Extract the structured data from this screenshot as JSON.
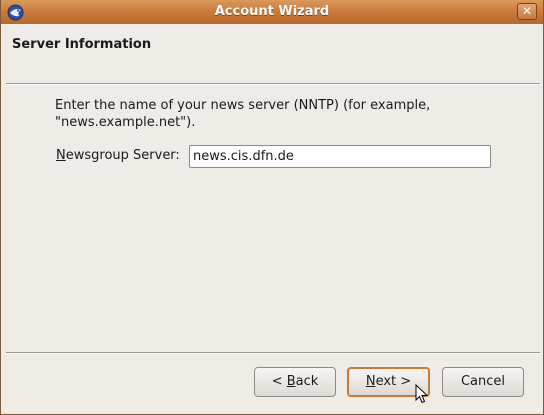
{
  "window": {
    "title": "Account Wizard",
    "close_label": "✕"
  },
  "page": {
    "title": "Server Information",
    "description_line1": "Enter the name of your news server (NNTP) (for example,",
    "description_line2": "\"news.example.net\")."
  },
  "form": {
    "server_label_mnemonic": "N",
    "server_label_rest": "ewsgroup Server:",
    "server_value": "news.cis.dfn.de"
  },
  "buttons": {
    "back_prefix": "< ",
    "back_mnemonic": "B",
    "back_rest": "ack",
    "next_mnemonic": "N",
    "next_rest": "ext >",
    "cancel": "Cancel"
  },
  "icons": {
    "app": "thunderbird-app-icon",
    "cursor": "mouse-pointer-icon"
  },
  "colors": {
    "titlebar": "#c9793a",
    "default_button_border": "#c9793a",
    "window_bg": "#efebe7"
  }
}
